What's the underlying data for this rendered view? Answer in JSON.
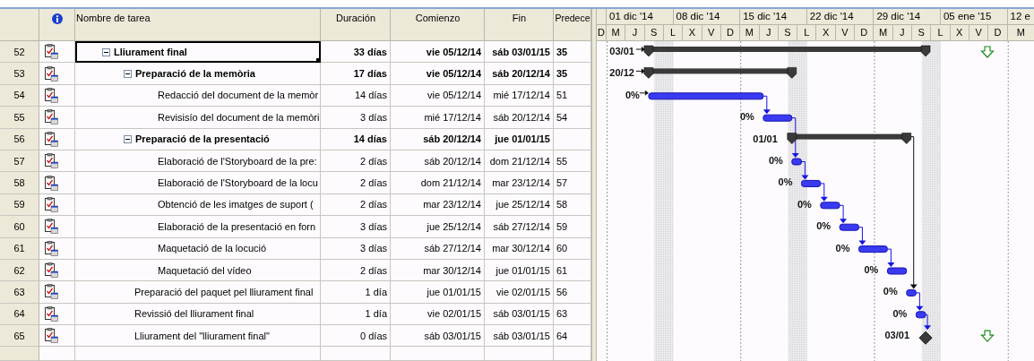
{
  "table": {
    "columns": [
      "Nombre de tarea",
      "Duración",
      "Comienzo",
      "Fin",
      "Predece"
    ],
    "rows": [
      {
        "id": "52",
        "kind": "summary",
        "expanded": true,
        "selected": true,
        "deadline": true,
        "name": "Lliurament final",
        "duration": "33 días",
        "start": "vie 05/12/14",
        "finish": "sáb 03/01/15",
        "predecessors": "35",
        "bar_label": "03/01",
        "children": [
          {
            "id": "53",
            "kind": "summary",
            "expanded": true,
            "selected": false,
            "deadline": false,
            "name": "Preparació de la memòria",
            "duration": "17 días",
            "start": "vie 05/12/14",
            "finish": "sáb 20/12/14",
            "predecessors": "35",
            "bar_label": "20/12",
            "children": [
              {
                "id": "54",
                "kind": "task",
                "selected": false,
                "deadline": false,
                "name": "Redacció del document de la memòr",
                "duration": "14 días",
                "start": "vie 05/12/14",
                "finish": "mié 17/12/14",
                "predecessors": "51",
                "bar_label": "0%"
              },
              {
                "id": "55",
                "kind": "task",
                "selected": false,
                "deadline": false,
                "name": "Revisisío del document de la memòri",
                "duration": "3 días",
                "start": "mié 17/12/14",
                "finish": "sáb 20/12/14",
                "predecessors": "54",
                "bar_label": "0%"
              }
            ]
          },
          {
            "id": "56",
            "kind": "summary",
            "expanded": true,
            "selected": false,
            "deadline": false,
            "name": "Preparació de la presentació",
            "duration": "14 días",
            "start": "sáb 20/12/14",
            "finish": "jue 01/01/15",
            "bar_label": "01/01",
            "children": [
              {
                "id": "57",
                "kind": "task",
                "selected": false,
                "deadline": false,
                "name": "Elaboració de l'Storyboard de la pre:",
                "duration": "2 días",
                "start": "sáb 20/12/14",
                "finish": "dom 21/12/14",
                "predecessors": "55",
                "bar_label": "0%"
              },
              {
                "id": "58",
                "kind": "task",
                "selected": false,
                "deadline": false,
                "name": "Elaboració de l'Storyboard de la locu",
                "duration": "2 días",
                "start": "dom 21/12/14",
                "finish": "mar 23/12/14",
                "predecessors": "57",
                "bar_label": "0%"
              },
              {
                "id": "59",
                "kind": "task",
                "selected": false,
                "deadline": false,
                "name": "Obtenció de les imatges de suport (",
                "duration": "2 días",
                "start": "mar 23/12/14",
                "finish": "jue 25/12/14",
                "predecessors": "58",
                "bar_label": "0%"
              },
              {
                "id": "60",
                "kind": "task",
                "selected": false,
                "deadline": false,
                "name": "Elaboració de la presentació en forn",
                "duration": "3 días",
                "start": "jue 25/12/14",
                "finish": "sáb 27/12/14",
                "predecessors": "59",
                "bar_label": "0%"
              },
              {
                "id": "61",
                "kind": "task",
                "selected": false,
                "deadline": false,
                "name": "Maquetació de la locució",
                "duration": "3 días",
                "start": "sáb 27/12/14",
                "finish": "mar 30/12/14",
                "predecessors": "60",
                "bar_label": "0%"
              },
              {
                "id": "62",
                "kind": "task",
                "selected": false,
                "deadline": false,
                "name": "Maquetació del vídeo",
                "duration": "2 días",
                "start": "mar 30/12/14",
                "finish": "jue 01/01/15",
                "predecessors": "61",
                "bar_label": "0%"
              }
            ]
          },
          {
            "id": "63",
            "kind": "task",
            "selected": false,
            "deadline": false,
            "name": "Preparació del paquet pel lliurament final",
            "duration": "1 día",
            "start": "jue 01/01/15",
            "finish": "vie 02/01/15",
            "predecessors": "56",
            "bar_label": "0%"
          },
          {
            "id": "64",
            "kind": "task",
            "selected": false,
            "deadline": false,
            "name": "Revissió del lliurament final",
            "duration": "1 día",
            "start": "vie 02/01/15",
            "finish": "sáb 03/01/15",
            "predecessors": "63",
            "bar_label": "0%"
          },
          {
            "id": "65",
            "kind": "milestone",
            "selected": false,
            "deadline": true,
            "name": "Lliurament del \"lliurament final\"",
            "duration": "0 días",
            "start": "sáb 03/01/15",
            "finish": "sáb 03/01/15",
            "predecessors": "64",
            "bar_label": "03/01"
          }
        ]
      }
    ]
  },
  "timescale": {
    "weeks": [
      "01 dic '14",
      "08 dic '14",
      "15 dic '14",
      "22 dic '14",
      "29 dic '14",
      "05 ene '15",
      "12 e"
    ],
    "days": [
      "D",
      "M",
      "J",
      "S",
      "L",
      "X",
      "V",
      "D",
      "M",
      "J",
      "S",
      "L",
      "X",
      "V",
      "D",
      "M",
      "J",
      "S",
      "L",
      "X",
      "V",
      "D",
      "M"
    ]
  }
}
